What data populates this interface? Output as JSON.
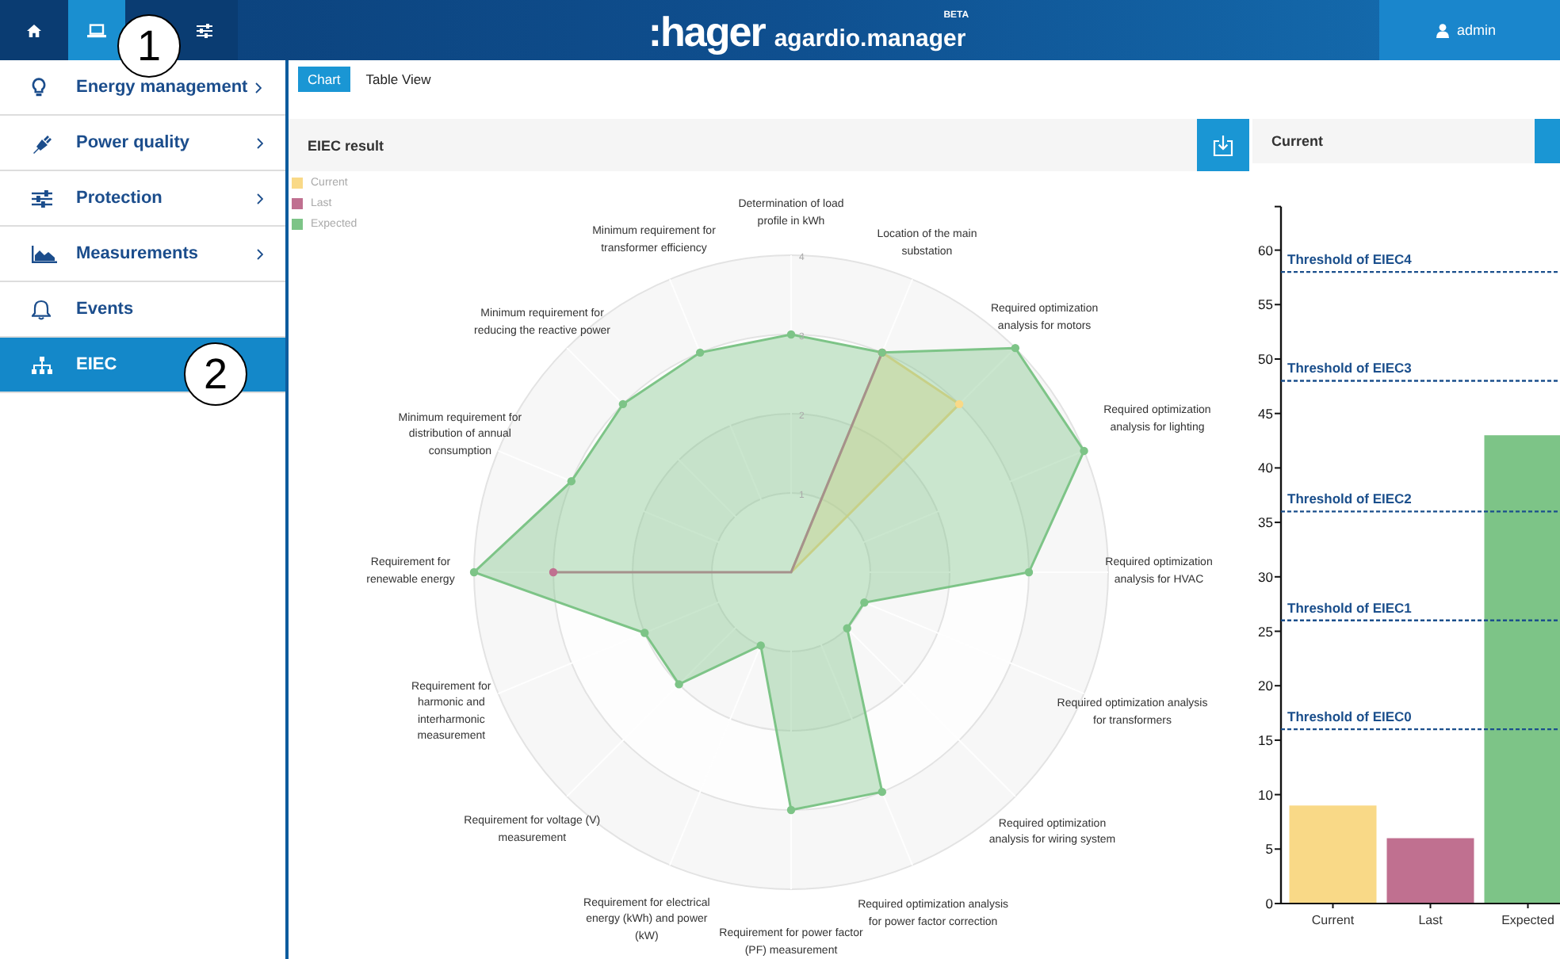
{
  "topbar": {
    "nav": [
      {
        "kind": "home",
        "selected": false
      },
      {
        "kind": "laptop",
        "selected": true
      },
      {
        "kind": "sliders",
        "selected": false
      }
    ],
    "logo": {
      "brand": ":hager",
      "product": "agardio.manager",
      "badge": "BETA"
    },
    "user": "admin"
  },
  "callouts": [
    "1",
    "2"
  ],
  "sidebar": {
    "items": [
      {
        "label": "Energy management",
        "kind": "bulb",
        "expandable": true,
        "selected": false
      },
      {
        "label": "Power quality",
        "kind": "plug",
        "expandable": true,
        "selected": false
      },
      {
        "label": "Protection",
        "kind": "sliders",
        "expandable": true,
        "selected": false
      },
      {
        "label": "Measurements",
        "kind": "area",
        "expandable": true,
        "selected": false
      },
      {
        "label": "Events",
        "kind": "bell",
        "expandable": false,
        "selected": false
      },
      {
        "label": "EIEC",
        "kind": "tree",
        "expandable": false,
        "selected": true
      }
    ]
  },
  "tabs": [
    {
      "label": "Chart",
      "selected": true
    },
    {
      "label": "Table View",
      "selected": false
    }
  ],
  "radar_panel": {
    "title": "EIEC result",
    "chart_data": {
      "type": "radar",
      "categories": [
        "Determination of load profile in kWh",
        "Location of the main substation",
        "Required optimization analysis for motors",
        "Required optimization analysis for lighting",
        "Required optimization analysis for HVAC",
        "Required optimization analysis for transformers",
        "Required optimization analysis for wiring system",
        "Required optimization analysis for power factor correction",
        "Requirement for power factor (PF) measurement",
        "Requirement for electrical energy (kWh) and power (kW)",
        "Requirement for voltage (V) measurement",
        "Requirement for harmonic and interharmonic measurement",
        "Requirement for renewable energy",
        "Minimum requirement for distribution of annual consumption",
        "Minimum requirement for reducing the reactive power",
        "Minimum requirement for transformer efficiency"
      ],
      "series": [
        {
          "name": "Current",
          "color": "#f9d987",
          "values": [
            0,
            3,
            3,
            0,
            0,
            0,
            0,
            0,
            0,
            0,
            0,
            0,
            0,
            0,
            0,
            0
          ]
        },
        {
          "name": "Last",
          "color": "#c07090",
          "values": [
            0,
            3,
            0,
            0,
            0,
            0,
            0,
            0,
            0,
            0,
            0,
            0,
            3,
            0,
            0,
            0
          ]
        },
        {
          "name": "Expected",
          "color": "#7dc487",
          "values": [
            3,
            3,
            4,
            4,
            3,
            1,
            1,
            3,
            3,
            1,
            2,
            2,
            4,
            3,
            3,
            3
          ]
        }
      ],
      "ylim": [
        0,
        4
      ],
      "yticks": [
        1,
        2,
        3,
        4
      ],
      "legend": "upper left"
    }
  },
  "bar_panel": {
    "title": "Current",
    "chart_data": {
      "type": "bar",
      "series": [
        {
          "name": "Current",
          "color": "#f9d987",
          "values": [
            9
          ]
        },
        {
          "name": "Last",
          "color": "#c07090",
          "values": [
            6
          ]
        },
        {
          "name": "Expected",
          "color": "#7dc487",
          "values": [
            43
          ]
        }
      ],
      "ylim": [
        0,
        64
      ],
      "yticks": [
        0,
        5,
        10,
        15,
        20,
        25,
        30,
        35,
        40,
        45,
        50,
        55,
        60
      ],
      "ref_lines": [
        {
          "axis": "y",
          "value": 58,
          "label": "Threshold of EIEC4"
        },
        {
          "axis": "y",
          "value": 48,
          "label": "Threshold of EIEC3"
        },
        {
          "axis": "y",
          "value": 36,
          "label": "Threshold of EIEC2"
        },
        {
          "axis": "y",
          "value": 26,
          "label": "Threshold of EIEC1"
        },
        {
          "axis": "y",
          "value": 16,
          "label": "Threshold of EIEC0"
        }
      ]
    }
  }
}
